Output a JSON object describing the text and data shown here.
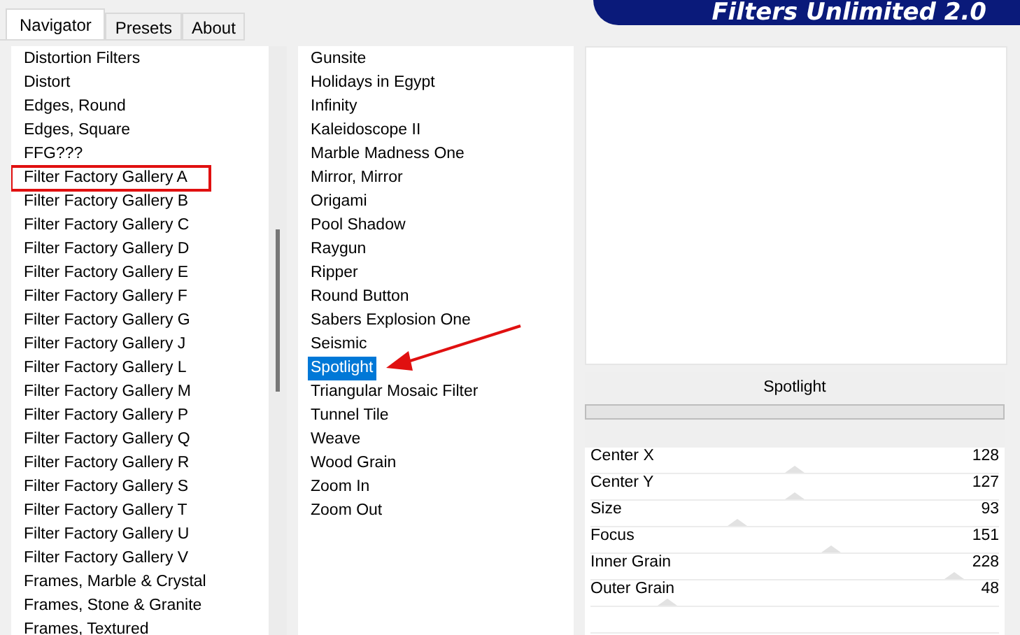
{
  "title": "Filters Unlimited 2.0",
  "tabs": [
    {
      "label": "Navigator",
      "selected": true
    },
    {
      "label": "Presets",
      "selected": false
    },
    {
      "label": "About",
      "selected": false
    }
  ],
  "categories": [
    {
      "label": "Distortion Filters",
      "highlighted": false
    },
    {
      "label": "Distort",
      "highlighted": false
    },
    {
      "label": "Edges, Round",
      "highlighted": false
    },
    {
      "label": "Edges, Square",
      "highlighted": false
    },
    {
      "label": "FFG???",
      "highlighted": false
    },
    {
      "label": "Filter Factory Gallery A",
      "highlighted": true
    },
    {
      "label": "Filter Factory Gallery B",
      "highlighted": false
    },
    {
      "label": "Filter Factory Gallery C",
      "highlighted": false
    },
    {
      "label": "Filter Factory Gallery D",
      "highlighted": false
    },
    {
      "label": "Filter Factory Gallery E",
      "highlighted": false
    },
    {
      "label": "Filter Factory Gallery F",
      "highlighted": false
    },
    {
      "label": "Filter Factory Gallery G",
      "highlighted": false
    },
    {
      "label": "Filter Factory Gallery J",
      "highlighted": false
    },
    {
      "label": "Filter Factory Gallery L",
      "highlighted": false
    },
    {
      "label": "Filter Factory Gallery M",
      "highlighted": false
    },
    {
      "label": "Filter Factory Gallery P",
      "highlighted": false
    },
    {
      "label": "Filter Factory Gallery Q",
      "highlighted": false
    },
    {
      "label": "Filter Factory Gallery R",
      "highlighted": false
    },
    {
      "label": "Filter Factory Gallery S",
      "highlighted": false
    },
    {
      "label": "Filter Factory Gallery T",
      "highlighted": false
    },
    {
      "label": "Filter Factory Gallery U",
      "highlighted": false
    },
    {
      "label": "Filter Factory Gallery V",
      "highlighted": false
    },
    {
      "label": "Frames, Marble & Crystal",
      "highlighted": false
    },
    {
      "label": "Frames, Stone & Granite",
      "highlighted": false
    },
    {
      "label": "Frames, Textured",
      "highlighted": false
    }
  ],
  "filters": [
    {
      "label": "Gunsite",
      "selected": false
    },
    {
      "label": "Holidays in Egypt",
      "selected": false
    },
    {
      "label": "Infinity",
      "selected": false
    },
    {
      "label": "Kaleidoscope II",
      "selected": false
    },
    {
      "label": "Marble Madness One",
      "selected": false
    },
    {
      "label": "Mirror, Mirror",
      "selected": false
    },
    {
      "label": "Origami",
      "selected": false
    },
    {
      "label": "Pool Shadow",
      "selected": false
    },
    {
      "label": "Raygun",
      "selected": false
    },
    {
      "label": "Ripper",
      "selected": false
    },
    {
      "label": "Round Button",
      "selected": false
    },
    {
      "label": "Sabers Explosion One",
      "selected": false
    },
    {
      "label": "Seismic",
      "selected": false
    },
    {
      "label": "Spotlight",
      "selected": true
    },
    {
      "label": "Triangular Mosaic Filter",
      "selected": false
    },
    {
      "label": "Tunnel Tile",
      "selected": false
    },
    {
      "label": "Weave",
      "selected": false
    },
    {
      "label": "Wood Grain",
      "selected": false
    },
    {
      "label": "Zoom In",
      "selected": false
    },
    {
      "label": "Zoom Out",
      "selected": false
    }
  ],
  "filter_name": "Spotlight",
  "sliders": [
    {
      "label": "Center X",
      "value": "128",
      "level": 0.5
    },
    {
      "label": "Center Y",
      "value": "127",
      "level": 0.5
    },
    {
      "label": "Size",
      "value": "93",
      "level": 0.36
    },
    {
      "label": "Focus",
      "value": "151",
      "level": 0.59
    },
    {
      "label": "Inner Grain",
      "value": "228",
      "level": 0.89
    },
    {
      "label": "Outer Grain",
      "value": "48",
      "level": 0.19
    }
  ]
}
